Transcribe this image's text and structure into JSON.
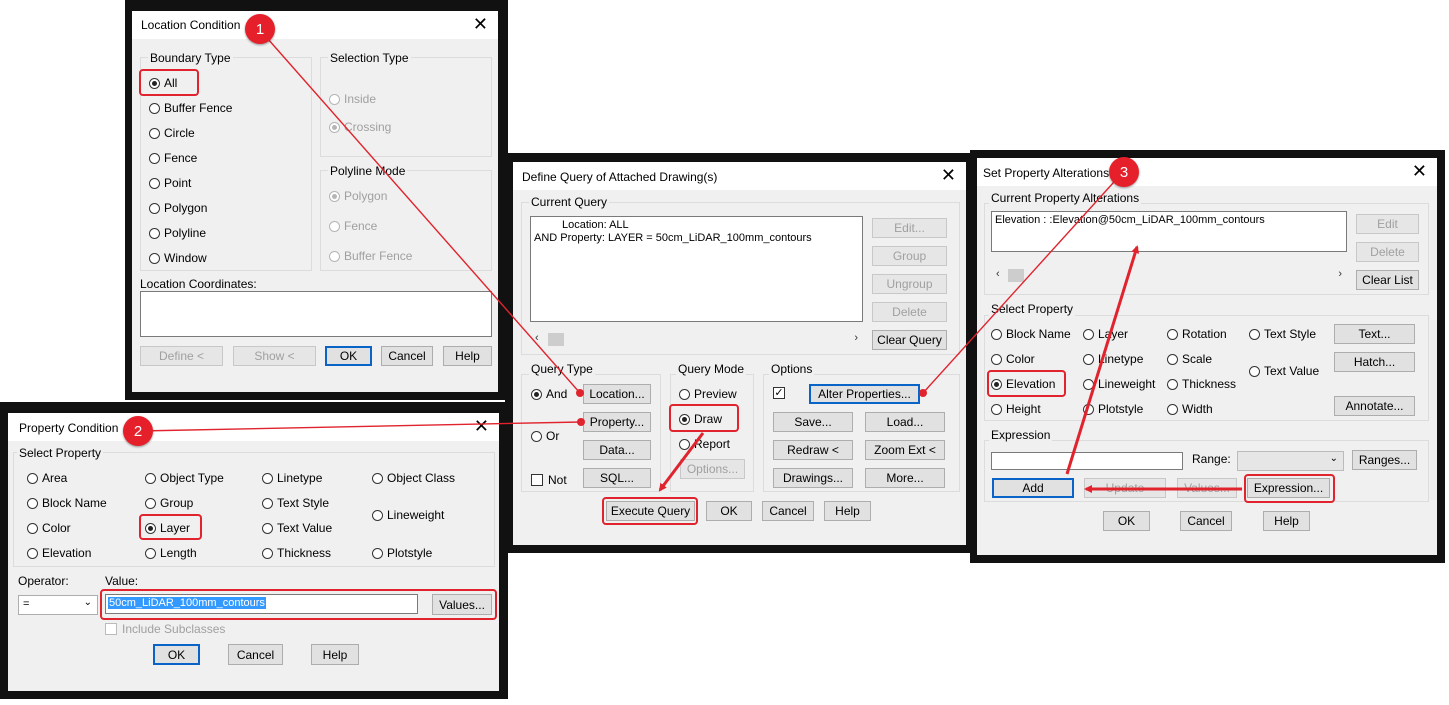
{
  "location_condition": {
    "title": "Location Condition",
    "badge": "1",
    "boundary_type_label": "Boundary Type",
    "boundary_types": [
      "All",
      "Buffer Fence",
      "Circle",
      "Fence",
      "Point",
      "Polygon",
      "Polyline",
      "Window"
    ],
    "selection_type_label": "Selection Type",
    "selection_types": [
      "Inside",
      "Crossing"
    ],
    "polyline_mode_label": "Polyline Mode",
    "polyline_modes": [
      "Polygon",
      "Fence",
      "Buffer Fence"
    ],
    "location_coordinates_label": "Location Coordinates:",
    "buttons": {
      "define": "Define <",
      "show": "Show <",
      "ok": "OK",
      "cancel": "Cancel",
      "help": "Help"
    }
  },
  "property_condition": {
    "title": "Property Condition",
    "badge": "2",
    "select_property_label": "Select Property",
    "properties": [
      "Area",
      "Object Type",
      "Linetype",
      "Object Class",
      "Block Name",
      "Group",
      "Text Style",
      "Lineweight",
      "Color",
      "Layer",
      "Text Value",
      "Elevation",
      "Length",
      "Thickness",
      "Plotstyle"
    ],
    "operator_label": "Operator:",
    "operator_value": "=",
    "value_label": "Value:",
    "value": "50cm_LiDAR_100mm_contours",
    "values_button": "Values...",
    "include_subclasses": "Include Subclasses",
    "buttons": {
      "ok": "OK",
      "cancel": "Cancel",
      "help": "Help"
    }
  },
  "define_query": {
    "title": "Define Query of Attached Drawing(s)",
    "current_query_label": "Current Query",
    "query_lines": [
      "Location: ALL",
      "AND  Property: LAYER = 50cm_LiDAR_100mm_contours"
    ],
    "side_buttons": {
      "edit": "Edit...",
      "group": "Group",
      "ungroup": "Ungroup",
      "delete": "Delete",
      "clear_query": "Clear Query"
    },
    "query_type_label": "Query Type",
    "query_types": {
      "and": "And",
      "or": "Or",
      "not": "Not"
    },
    "qt_buttons": {
      "location": "Location...",
      "property": "Property...",
      "data": "Data...",
      "sql": "SQL..."
    },
    "query_mode_label": "Query Mode",
    "query_modes": {
      "preview": "Preview",
      "draw": "Draw",
      "report": "Report"
    },
    "options_button": "Options...",
    "options_label": "Options",
    "opt_buttons": {
      "alter": "Alter Properties...",
      "save": "Save...",
      "load": "Load...",
      "redraw": "Redraw <",
      "zoom": "Zoom Ext <",
      "drawings": "Drawings...",
      "more": "More..."
    },
    "buttons": {
      "execute": "Execute Query",
      "ok": "OK",
      "cancel": "Cancel",
      "help": "Help"
    }
  },
  "property_alterations": {
    "title": "Set Property Alterations",
    "badge": "3",
    "current_label": "Current Property Alterations",
    "alteration": "Elevation : :Elevation@50cm_LiDAR_100mm_contours",
    "side_buttons": {
      "edit": "Edit",
      "delete": "Delete",
      "clear_list": "Clear List"
    },
    "select_property_label": "Select Property",
    "properties": {
      "block_name": "Block Name",
      "layer": "Layer",
      "rotation": "Rotation",
      "text_style": "Text Style",
      "color": "Color",
      "linetype": "Linetype",
      "scale": "Scale",
      "text_value": "Text Value",
      "elevation": "Elevation",
      "lineweight": "Lineweight",
      "thickness": "Thickness",
      "height": "Height",
      "plotstyle": "Plotstyle",
      "width": "Width"
    },
    "prop_buttons": {
      "text": "Text...",
      "hatch": "Hatch...",
      "annotate": "Annotate..."
    },
    "expression_label": "Expression",
    "range_label": "Range:",
    "ranges_button": "Ranges...",
    "expr_buttons": {
      "add": "Add",
      "update": "Update",
      "values": "Values...",
      "expression": "Expression..."
    },
    "buttons": {
      "ok": "OK",
      "cancel": "Cancel",
      "help": "Help"
    }
  },
  "colors": {
    "highlight": "#e0232d",
    "badge": "#e5202a",
    "default_button": "#0a64c8",
    "selection": "#3399ff"
  }
}
